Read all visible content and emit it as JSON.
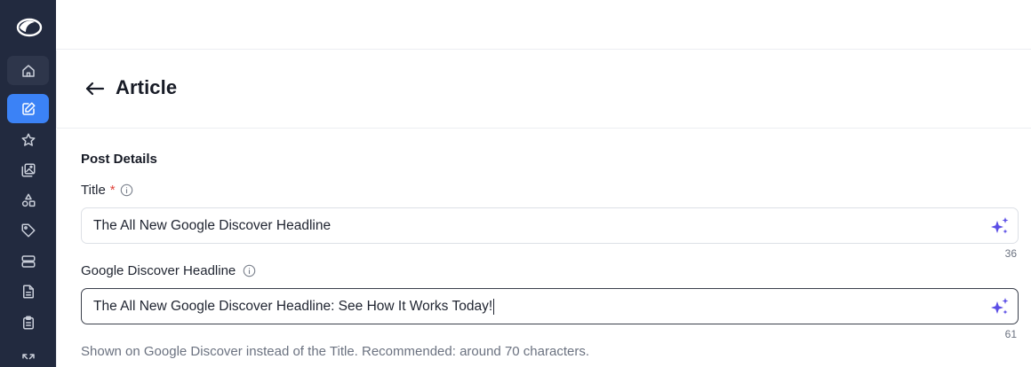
{
  "header": {
    "title": "Article"
  },
  "sidebar": {
    "items": [
      {
        "icon": "home-icon"
      },
      {
        "icon": "edit-icon",
        "active": true
      },
      {
        "icon": "star-icon"
      },
      {
        "icon": "image-gallery-icon"
      },
      {
        "icon": "shapes-icon"
      },
      {
        "icon": "tag-icon"
      },
      {
        "icon": "server-icon"
      },
      {
        "icon": "document-icon"
      },
      {
        "icon": "clipboard-icon"
      },
      {
        "icon": "expand-icon"
      }
    ]
  },
  "form": {
    "section_title": "Post Details",
    "title_field": {
      "label": "Title",
      "required_mark": "*",
      "value": "The All New Google Discover Headline",
      "count": "36"
    },
    "discover_field": {
      "label": "Google Discover Headline",
      "value": "The All New Google Discover Headline: See How It Works Today!",
      "count": "61",
      "helper": "Shown on Google Discover instead of the Title. Recommended: around 70 characters."
    }
  },
  "colors": {
    "sidebar_bg": "#222a3f",
    "active_nav": "#3b82f6",
    "sparkle": "#5b4ee6",
    "required": "#e0433a"
  }
}
